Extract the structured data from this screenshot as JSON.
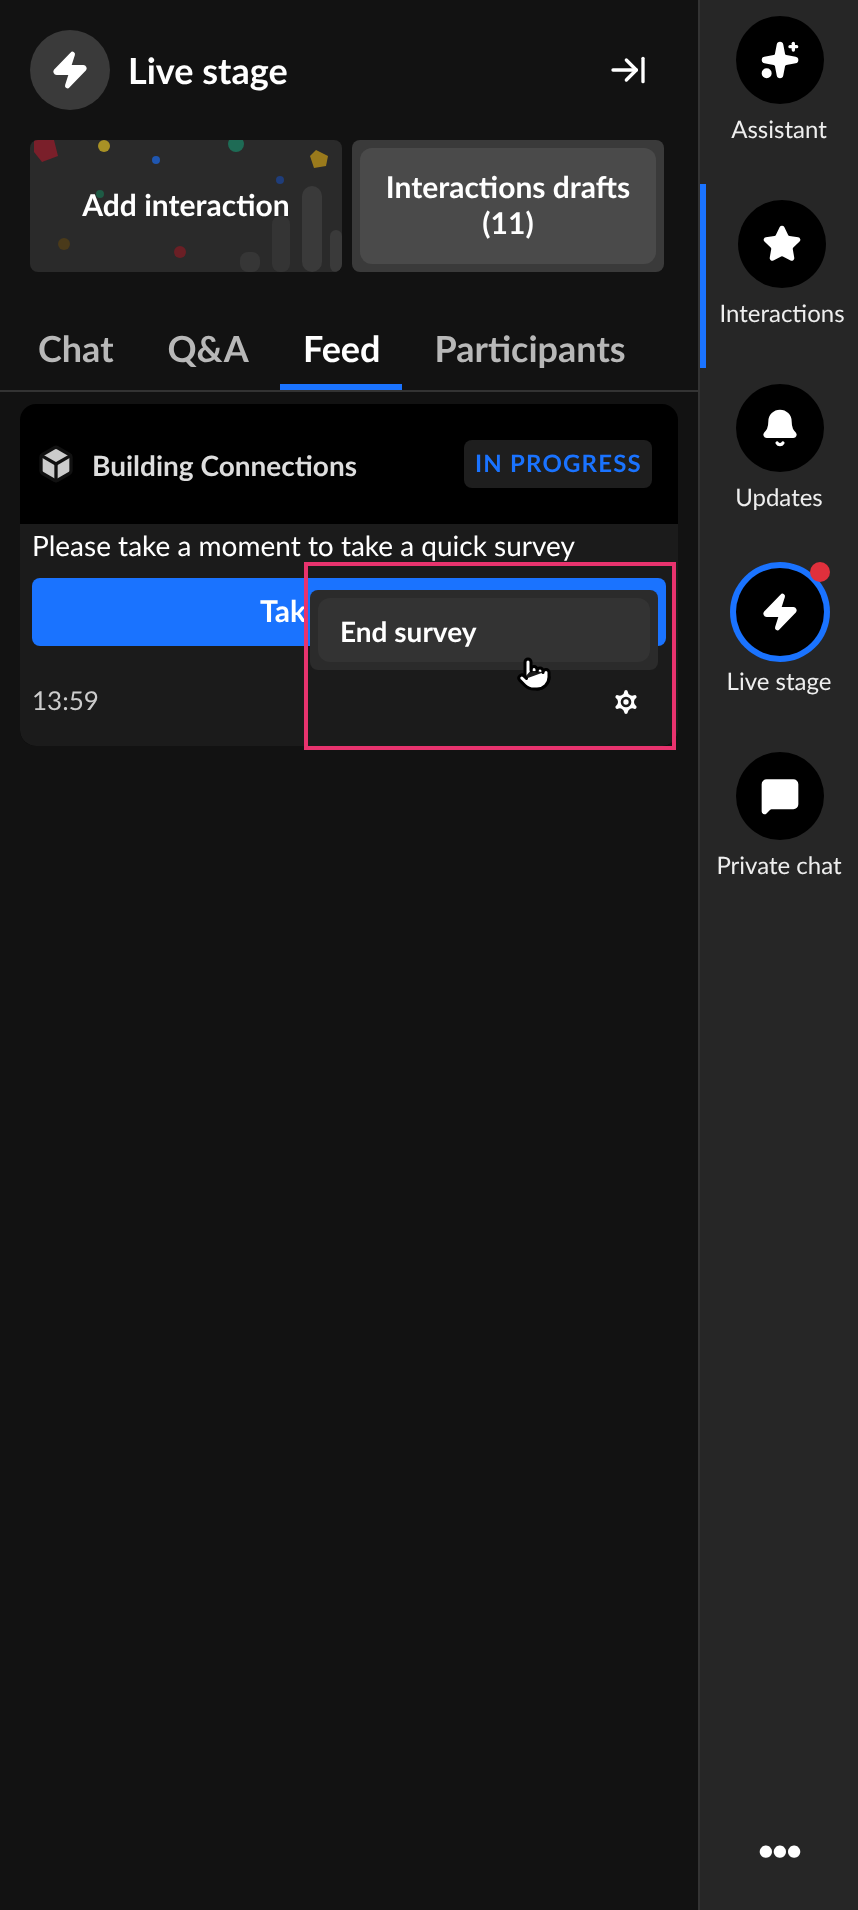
{
  "header": {
    "title": "Live stage"
  },
  "actions": [
    {
      "kind": "decorated",
      "label": "Add interaction"
    },
    {
      "kind": "plain",
      "label": "Interactions drafts (11)"
    }
  ],
  "tabs": [
    {
      "label": "Chat",
      "selected": false
    },
    {
      "label": "Q&A",
      "selected": false
    },
    {
      "label": "Feed",
      "selected": true
    },
    {
      "label": "Participants",
      "selected": false
    }
  ],
  "feed_card": {
    "title": "Building Connections",
    "status": "IN PROGRESS",
    "message": "Please take a moment to take a quick survey",
    "button": "Tak",
    "time": "13:59"
  },
  "menu": {
    "items": [
      "End survey"
    ]
  },
  "sidebar": {
    "items": [
      {
        "label": "Assistant",
        "kind": "sparkles",
        "selected": false,
        "ring": false,
        "badge": false
      },
      {
        "label": "Interactions",
        "kind": "star",
        "selected": true,
        "ring": false,
        "badge": false
      },
      {
        "label": "Updates",
        "kind": "bell",
        "selected": false,
        "ring": false,
        "badge": false
      },
      {
        "label": "Live stage",
        "kind": "bolt",
        "selected": false,
        "ring": true,
        "badge": true
      },
      {
        "label": "Private chat",
        "kind": "chat",
        "selected": false,
        "ring": false,
        "badge": false
      }
    ],
    "more": "•••"
  }
}
